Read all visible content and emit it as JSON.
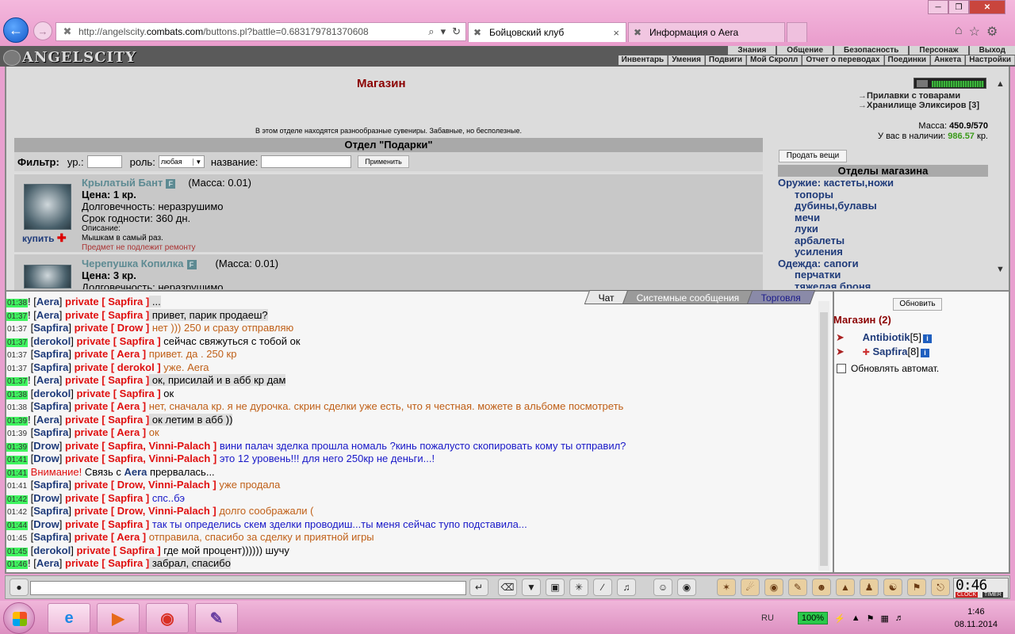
{
  "browser": {
    "url_prefix": "http://angelscity.",
    "url_domain": "combats.com",
    "url_rest": "/buttons.pl?battle=0.683179781370608",
    "tabs": [
      {
        "label": "Бойцовский клуб"
      },
      {
        "label": "Информация о Aera"
      }
    ]
  },
  "game": {
    "logo": "ANGELSCITY",
    "top_menu": [
      "Знания",
      "Общение",
      "Безопасность",
      "Персонаж",
      "Выход"
    ],
    "sub_menu": [
      "Инвентарь",
      "Умения",
      "Подвиги",
      "Мой Скролл",
      "Отчет о переводах",
      "Поединки",
      "Анкета",
      "Настройки"
    ]
  },
  "shop": {
    "title": "Магазин",
    "description": "В этом отделе находятся разнообразные сувениры. Забавные, но бесполезные.",
    "department_title": "Отдел \"Подарки\"",
    "filter": {
      "label": "Фильтр:",
      "level_label": "ур.:",
      "role_label": "роль:",
      "role_value": "любая",
      "name_label": "название:",
      "apply": "Применить"
    },
    "items": [
      {
        "name": "Крылатый Бант",
        "badge": "F",
        "mass": "(Масса: 0.01)",
        "price": "Цена: 1 кр.",
        "durability": "Долговечность: неразрушимо",
        "expiry": "Срок годности: 360 дн.",
        "desc_label": "Описание:",
        "desc": "Мышкам в самый раз.",
        "repair": "Предмет не подлежит ремонту",
        "buy": "купить"
      },
      {
        "name": "Черепушка Копилка",
        "badge": "F",
        "mass": "(Масса: 0.01)",
        "price": "Цена: 3 кр.",
        "durability": "Долговечность: неразрушимо"
      }
    ],
    "right_links": [
      "Прилавки с товарами",
      "Хранилище Эликсиров [3]"
    ],
    "mass_label": "Масса:",
    "mass_value": "450.9/570",
    "cash_label": "У вас в наличии:",
    "cash_value": "986.57",
    "cash_unit": "кр.",
    "sell_button": "Продать вещи",
    "departments_title": "Отделы магазина",
    "departments": [
      {
        "cat": "Оружие: кастеты,ножи",
        "subs": [
          "топоры",
          "дубины,булавы",
          "мечи",
          "луки",
          "арбалеты",
          "усиления"
        ]
      },
      {
        "cat": "Одежда: сапоги",
        "subs": [
          "перчатки",
          "тяжелая броня"
        ]
      }
    ]
  },
  "chat": {
    "tabs": [
      "Чат",
      "Системные сообщения",
      "Торговля"
    ],
    "lines": [
      {
        "time": "01:38",
        "hl": true,
        "prefix": "! [",
        "nick": "Aera",
        "mid": "] ",
        "priv": "private [ Sapfira ]",
        "msg": " ...",
        "cls": "msg-k",
        "mhl": true
      },
      {
        "time": "01:37",
        "hl": true,
        "prefix": "! [",
        "nick": "Aera",
        "mid": "] ",
        "priv": "private [ Sapfira ]",
        "msg": " привет, парик продаеш?",
        "cls": "msg-k",
        "mhl": true
      },
      {
        "time": "01:37",
        "hl": false,
        "prefix": " [",
        "nick": "Sapfira",
        "mid": "] ",
        "priv": "private [ Drow ]",
        "msg": " нет ))) 250 и сразу отправляю",
        "cls": "msg-o",
        "mhl": false
      },
      {
        "time": "01:37",
        "hl": true,
        "prefix": " [",
        "nick": "derokol",
        "mid": "] ",
        "priv": "private [ Sapfira ]",
        "msg": " сейчас свяжуться с тобой ок",
        "cls": "msg-k",
        "mhl": false
      },
      {
        "time": "01:37",
        "hl": false,
        "prefix": " [",
        "nick": "Sapfira",
        "mid": "] ",
        "priv": "private [ Aera ]",
        "msg": " привет. да . 250 кр",
        "cls": "msg-o",
        "mhl": false
      },
      {
        "time": "01:37",
        "hl": false,
        "prefix": " [",
        "nick": "Sapfira",
        "mid": "] ",
        "priv": "private [ derokol ]",
        "msg": " уже. Aera",
        "cls": "msg-o",
        "mhl": false
      },
      {
        "time": "01:37",
        "hl": true,
        "prefix": "! [",
        "nick": "Aera",
        "mid": "] ",
        "priv": "private [ Sapfira ]",
        "msg": " ок, присилай и в абб кр дам",
        "cls": "msg-k",
        "mhl": true
      },
      {
        "time": "01:38",
        "hl": true,
        "prefix": " [",
        "nick": "derokol",
        "mid": "] ",
        "priv": "private [ Sapfira ]",
        "msg": " ок",
        "cls": "msg-k",
        "mhl": false
      },
      {
        "time": "01:38",
        "hl": false,
        "prefix": " [",
        "nick": "Sapfira",
        "mid": "] ",
        "priv": "private [ Aera ]",
        "msg": " нет, сначала кр. я не дурочка. скрин сделки уже есть, что я честная. можете в альбоме посмотреть",
        "cls": "msg-o",
        "mhl": false
      },
      {
        "time": "01:39",
        "hl": true,
        "prefix": "! [",
        "nick": "Aera",
        "mid": "] ",
        "priv": "private [ Sapfira ]",
        "msg": " ок летим в абб ))",
        "cls": "msg-k",
        "mhl": true
      },
      {
        "time": "01:39",
        "hl": false,
        "prefix": " [",
        "nick": "Sapfira",
        "mid": "] ",
        "priv": "private [ Aera ]",
        "msg": " ок",
        "cls": "msg-o",
        "mhl": false
      },
      {
        "time": "01:39",
        "hl": true,
        "prefix": " [",
        "nick": "Drow",
        "mid": "] ",
        "priv": "private [ Sapfira, Vinni-Palach ]",
        "msg": " вини палач зделка прошла номаль ?кинь пожалусто скопировать кому ты отправил?",
        "cls": "msg-b",
        "mhl": false
      },
      {
        "time": "01:41",
        "hl": true,
        "prefix": " [",
        "nick": "Drow",
        "mid": "] ",
        "priv": "private [ Sapfira, Vinni-Palach ]",
        "msg": " это 12 уровень!!! для него 250кр не деньги...!",
        "cls": "msg-b",
        "mhl": false
      },
      {
        "time": "01:41",
        "hl": true,
        "sys": true,
        "sys_pre": " Внимание!",
        "sys_mid": " Связь с ",
        "nick": "Aera",
        "sys_post": " прервалась..."
      },
      {
        "time": "01:41",
        "hl": false,
        "prefix": " [",
        "nick": "Sapfira",
        "mid": "] ",
        "priv": "private [ Drow, Vinni-Palach ]",
        "msg": " уже продала",
        "cls": "msg-o",
        "mhl": false
      },
      {
        "time": "01:42",
        "hl": true,
        "prefix": " [",
        "nick": "Drow",
        "mid": "] ",
        "priv": "private [ Sapfira ]",
        "msg": " спс..бэ",
        "cls": "msg-b",
        "mhl": false
      },
      {
        "time": "01:42",
        "hl": false,
        "prefix": " [",
        "nick": "Sapfira",
        "mid": "] ",
        "priv": "private [ Drow, Vinni-Palach ]",
        "msg": " долго соображали (",
        "cls": "msg-o",
        "mhl": false
      },
      {
        "time": "01:44",
        "hl": true,
        "prefix": " [",
        "nick": "Drow",
        "mid": "] ",
        "priv": "private [ Sapfira ]",
        "msg": " так ты определись скем зделки проводиш...ты меня сейчас тупо подставила...",
        "cls": "msg-b",
        "mhl": false
      },
      {
        "time": "01:45",
        "hl": false,
        "prefix": " [",
        "nick": "Sapfira",
        "mid": "] ",
        "priv": "private [ Aera ]",
        "msg": " отправила, спасибо за сделку и приятной игры",
        "cls": "msg-o",
        "mhl": false
      },
      {
        "time": "01:45",
        "hl": true,
        "prefix": " [",
        "nick": "derokol",
        "mid": "] ",
        "priv": "private [ Sapfira ]",
        "msg": " где мой процент)))))) шучу",
        "cls": "msg-k",
        "mhl": false
      },
      {
        "time": "01:46",
        "hl": true,
        "prefix": "! [",
        "nick": "Aera",
        "mid": "] ",
        "priv": "private [ Sapfira ]",
        "msg": " забрал, спасибо",
        "cls": "msg-k",
        "mhl": true
      }
    ]
  },
  "room": {
    "refresh": "Обновить",
    "title": "Магазин (2)",
    "users": [
      {
        "name": "Antibiotik",
        "level": "[5]"
      },
      {
        "name": "Sapfira",
        "level": "[8]"
      }
    ],
    "auto_refresh": "Обновлять автомат."
  },
  "clock": {
    "time": "0:46",
    "label1": "CLOCK",
    "label2": "TIMER"
  },
  "taskbar": {
    "lang": "RU",
    "battery": "100%",
    "time": "1:46",
    "date": "08.11.2014"
  }
}
